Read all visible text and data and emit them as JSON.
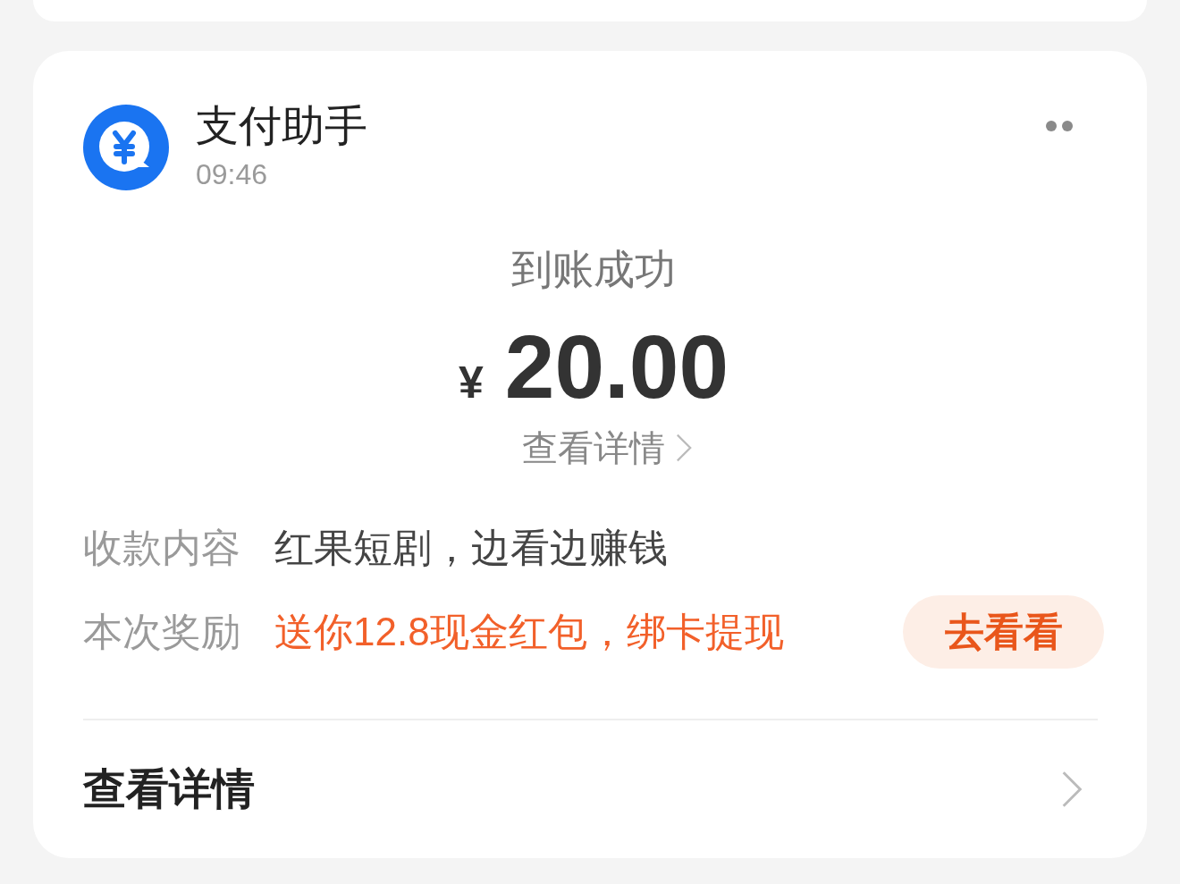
{
  "message": {
    "sender": "支付助手",
    "time": "09:46"
  },
  "receipt": {
    "status": "到账成功",
    "currency": "¥",
    "amount": "20.00",
    "detail_link": "查看详情"
  },
  "fields": [
    {
      "kind": "plain",
      "label": "收款内容",
      "value": "红果短剧，边看边赚钱"
    },
    {
      "kind": "reward",
      "label": "本次奖励",
      "value": "送你12.8现金红包，绑卡提现",
      "action": "去看看"
    }
  ],
  "footer": {
    "label": "查看详情"
  }
}
